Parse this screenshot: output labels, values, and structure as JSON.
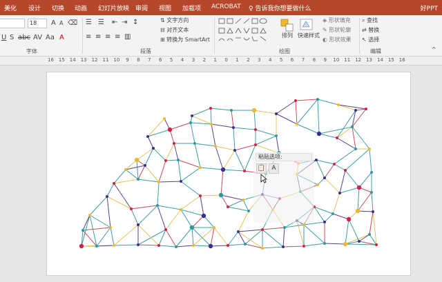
{
  "menu": {
    "tabs": [
      "美化",
      "设计",
      "切换",
      "动画",
      "幻灯片放映",
      "审阅",
      "视图",
      "加载项",
      "ACROBAT"
    ],
    "tell_me": "告诉我你想要做什么",
    "user": "好PPT"
  },
  "ribbon": {
    "font_name": "",
    "font_size": "18",
    "groups": {
      "font": "字体",
      "paragraph": "段落",
      "drawing": "绘图",
      "editing": "编辑"
    },
    "paragraph": {
      "text_direction": "文字方向",
      "align_text": "对齐文本",
      "convert_smartart": "转换为 SmartArt"
    },
    "drawing": {
      "arrange": "排列",
      "quick_styles": "快速样式",
      "shape_fill": "形状填充",
      "shape_outline": "形状轮廓",
      "shape_effects": "形状效果"
    },
    "editing": {
      "find": "查找",
      "replace": "替换",
      "select": "选择"
    }
  },
  "ruler": {
    "labels": [
      "16",
      "15",
      "14",
      "13",
      "12",
      "11",
      "10",
      "9",
      "8",
      "7",
      "6",
      "5",
      "4",
      "3",
      "2",
      "1",
      "0",
      "1",
      "2",
      "3",
      "4",
      "5",
      "6",
      "7",
      "8",
      "9",
      "10",
      "11",
      "12",
      "13",
      "14",
      "15",
      "16"
    ]
  },
  "paste_popup": {
    "title": "粘贴选项:"
  },
  "colors": {
    "accent": "#b7472a",
    "node_red": "#d81b4a",
    "node_purple": "#3d2c8c",
    "node_gold": "#f0b72a",
    "node_teal": "#2a9aa0",
    "edge_teal": "#3a9ea3",
    "edge_gold": "#e5c25a",
    "edge_purple": "#5a3d8c",
    "edge_red": "#c84a5a"
  }
}
